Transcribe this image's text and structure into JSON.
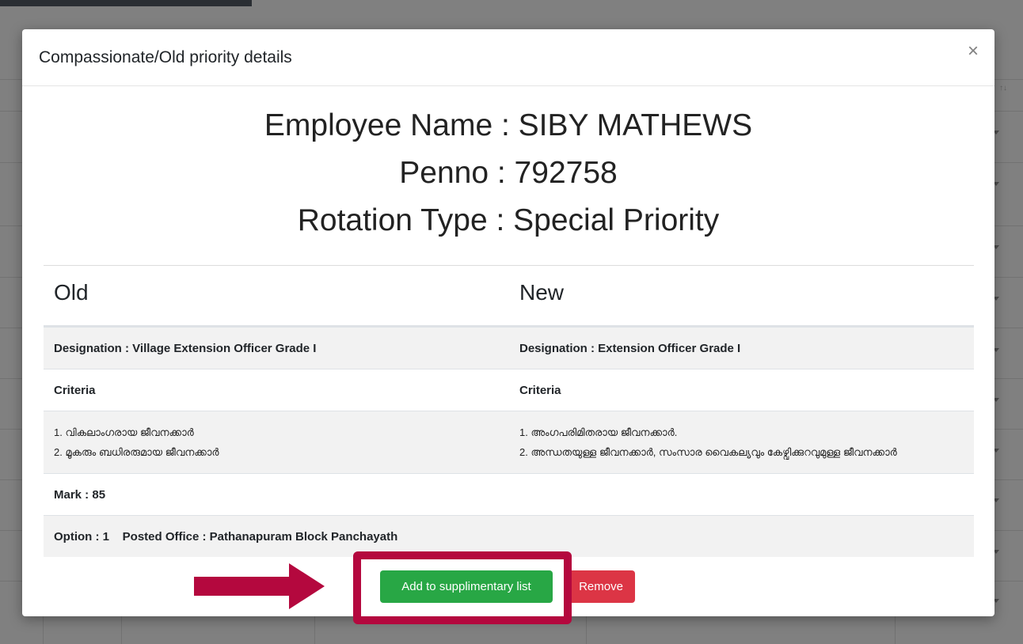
{
  "modal": {
    "title": "Compassionate/Old priority details",
    "close_symbol": "×"
  },
  "employee": {
    "name_line": "Employee Name : SIBY MATHEWS",
    "penno_line": "Penno : 792758",
    "rotation_line": "Rotation Type : Special Priority"
  },
  "table": {
    "headers": {
      "old": "Old",
      "new": "New"
    },
    "designation": {
      "old": "Designation : Village Extension Officer Grade I",
      "new": "Designation : Extension Officer Grade I"
    },
    "criteria_label": {
      "old": "Criteria",
      "new": "Criteria"
    },
    "criteria_items": {
      "old": [
        "1. വികലാംഗരായ ജീവനക്കാർ",
        "2. മൂകരും ബധിരരുമായ ജീവനക്കാർ"
      ],
      "new": [
        "1. അംഗപരിമിതരായ ജീവനക്കാർ.",
        "2. അന്ധതയുള്ള ജീവനക്കാർ, സംസാര വൈകല്യവും കേഴ്വിക്കുറവുമുള്ള ജീവനക്കാർ"
      ]
    },
    "mark": "Mark : 85",
    "option_line": "Option : 1    Posted Office : Pathanapuram Block Panchayath"
  },
  "buttons": {
    "add_label": "Add to supplimentary list",
    "remove_label": "Remove"
  },
  "colors": {
    "add_button": "#28a745",
    "remove_button": "#dc3545",
    "annotation": "#b4083e",
    "backdrop": "#808080"
  },
  "background": {
    "sort_icon": "↑↓"
  }
}
